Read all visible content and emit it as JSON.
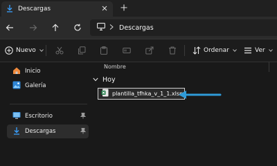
{
  "window": {
    "tab_title": "Descargas",
    "new_tab_glyph": "+"
  },
  "navigation": {
    "back_icon": "arrow-left-icon",
    "forward_icon": "arrow-right-icon",
    "up_icon": "arrow-up-icon",
    "refresh_icon": "refresh-icon",
    "address_path": "Descargas"
  },
  "toolbar": {
    "new_label": "Nuevo",
    "sort_label": "Ordenar",
    "view_label": "Ver"
  },
  "sidebar": {
    "items": [
      {
        "label": "Inicio",
        "icon": "home-icon"
      },
      {
        "label": "Galería",
        "icon": "gallery-icon"
      },
      {
        "label": "Escritorio",
        "icon": "desktop-icon"
      },
      {
        "label": "Descargas",
        "icon": "download-icon"
      }
    ]
  },
  "main": {
    "column_name": "Nombre",
    "group_label": "Hoy",
    "files": [
      {
        "name": "plantilla_tfhka_v_1_1.xlsm",
        "icon": "excel-file-icon"
      }
    ]
  },
  "colors": {
    "accent": "#3aa0ff",
    "arrow": "#2f9bd8",
    "excel_green": "#1f7a45"
  }
}
